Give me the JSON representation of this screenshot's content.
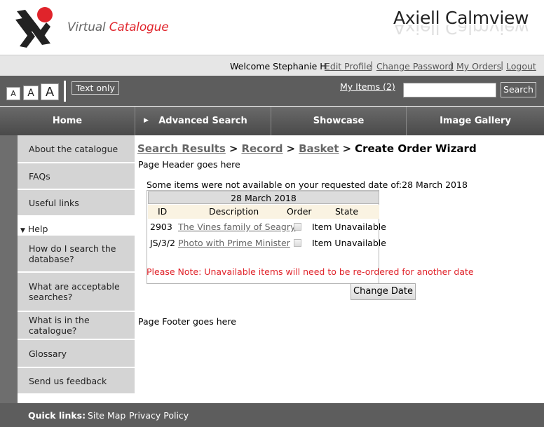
{
  "header": {
    "logo_text_prefix": "Virtual ",
    "logo_text_accent": "Catalogue",
    "brand": "Axiell Calmview",
    "colors": {
      "accent": "#e0242b",
      "bar": "#5d5d5d"
    }
  },
  "userbar": {
    "welcome": "Welcome Stephanie H",
    "links": [
      "Edit Profile",
      "Change Password",
      "My Orders",
      "Logout"
    ]
  },
  "tools": {
    "font_sizes": [
      "A",
      "A",
      "A"
    ],
    "text_only": "Text only",
    "my_items": "My Items (2)",
    "search_placeholder": "",
    "search_button": "Search"
  },
  "nav": {
    "items": [
      "Home",
      "Advanced Search",
      "Showcase",
      "Image Gallery"
    ]
  },
  "sidebar": {
    "items": [
      "About the catalogue",
      "FAQs",
      "Useful links"
    ],
    "help_label": "Help",
    "help_items": [
      "How do I search the database?",
      "What are acceptable searches?",
      "What is in the catalogue?",
      "Glossary",
      "Send us feedback"
    ]
  },
  "main": {
    "breadcrumb": [
      "Search Results",
      "Record",
      "Basket"
    ],
    "breadcrumb_current": "Create Order Wizard",
    "page_header": "Page Header goes here",
    "notice": "Some items were not available on your requested date of:28 March 2018",
    "table": {
      "date": "28 March 2018",
      "columns": [
        "ID",
        "Description",
        "Order",
        "State"
      ],
      "rows": [
        {
          "id": "2903",
          "description": "The Vines family of Seagry",
          "order": false,
          "state": "Item Unavailable"
        },
        {
          "id": "JS/3/2",
          "description": "Photo with Prime Minister",
          "order": false,
          "state": "Item Unavailable"
        }
      ]
    },
    "warning": "Please Note: Unavailable items will need to be re-ordered for another date",
    "change_date_button": "Change Date",
    "page_footer": "Page Footer goes here"
  },
  "footer": {
    "quick_links_label": "Quick links:",
    "links": [
      "Site Map",
      "Privacy Policy"
    ]
  }
}
